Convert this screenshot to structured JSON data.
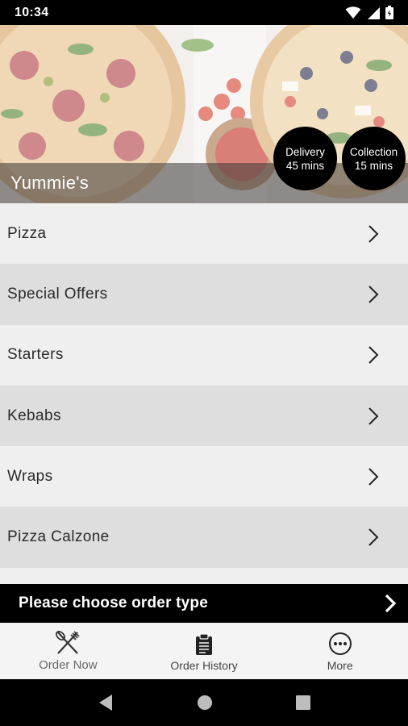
{
  "status_bar": {
    "time": "10:34",
    "icons": [
      "wifi-icon",
      "signal-icon",
      "battery-icon"
    ]
  },
  "hero": {
    "restaurant_name": "Yummie's",
    "delivery": {
      "label": "Delivery",
      "time": "45 mins"
    },
    "collection": {
      "label": "Collection",
      "time": "15 mins"
    }
  },
  "menu": {
    "categories": [
      {
        "label": "Pizza"
      },
      {
        "label": "Special Offers"
      },
      {
        "label": "Starters"
      },
      {
        "label": "Kebabs"
      },
      {
        "label": "Wraps"
      },
      {
        "label": "Pizza Calzone"
      }
    ]
  },
  "order_bar": {
    "label": "Please choose order type"
  },
  "bottom_nav": {
    "items": [
      {
        "label": "Order Now",
        "icon": "fork-knife-icon"
      },
      {
        "label": "Order History",
        "icon": "clipboard-icon"
      },
      {
        "label": "More",
        "icon": "more-dots-icon"
      }
    ]
  },
  "system_nav": {
    "icons": [
      "back-icon",
      "home-icon",
      "recents-icon"
    ]
  },
  "colors": {
    "bar_black": "#000000",
    "row_light": "#efefef",
    "row_dark": "#dedede"
  }
}
